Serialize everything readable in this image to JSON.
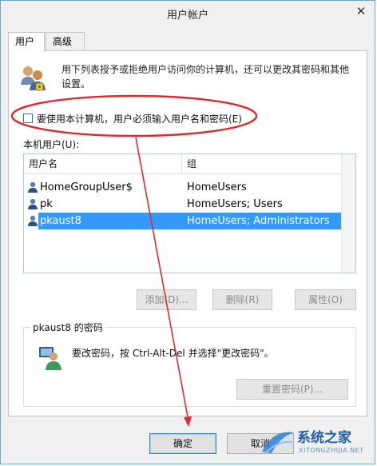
{
  "window": {
    "title": "用户帐户",
    "close_glyph": "✕"
  },
  "tabs": [
    {
      "label": "用户",
      "active": true
    },
    {
      "label": "高级",
      "active": false
    }
  ],
  "intro": {
    "text": "用下列表授予或拒绝用户访问你的计算机，还可以更改其密码和其他设置。",
    "icon": "users-icon"
  },
  "require_password": {
    "label": "要使用本计算机，用户必须输入用户名和密码(E)",
    "checked": false
  },
  "local_users": {
    "label": "本机用户(U):",
    "columns": [
      "用户名",
      "组"
    ],
    "rows": [
      {
        "name": "HomeGroupUser$",
        "group": "HomeUsers",
        "selected": false
      },
      {
        "name": "pk",
        "group": "HomeUsers; Users",
        "selected": false
      },
      {
        "name": "pkaust8",
        "group": "HomeUsers; Administrators",
        "selected": true
      }
    ]
  },
  "user_buttons": {
    "add": "添加(D)...",
    "remove": "删除(R)",
    "properties": "属性(O)"
  },
  "password_group": {
    "title": "pkaust8 的密码",
    "text": "要改密码，按 Ctrl-Alt-Del 并选择\"更改密码\"。",
    "reset_button": "重置密码(P)..."
  },
  "dialog_buttons": {
    "ok": "确定",
    "cancel": "取消"
  },
  "watermark": {
    "text": "系统之家",
    "url": "XITONGZHIJIA.NET"
  },
  "colors": {
    "selection": "#3399ff",
    "annotation": "#e0292f",
    "accent": "#3c7fb1"
  }
}
